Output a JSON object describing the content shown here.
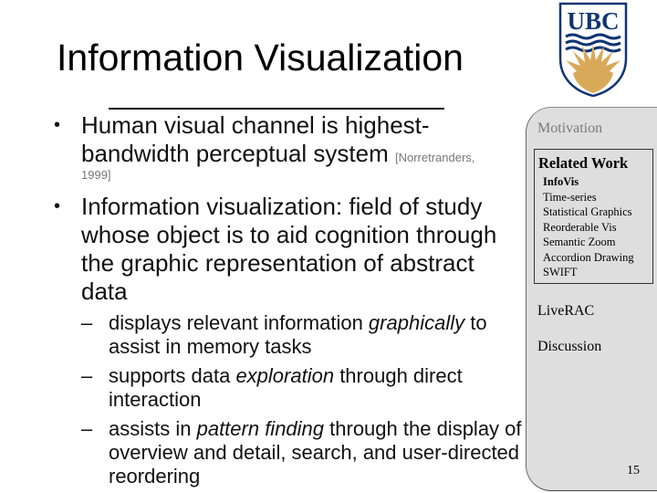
{
  "slide": {
    "title": "Information Visualization",
    "page_number": "15",
    "bullets": [
      {
        "text": "Human visual channel is highest-bandwidth perceptual system",
        "citation_1": "[Norretranders,",
        "citation_2": "1999]"
      },
      {
        "text": "Information visualization: field of study whose object is to aid cognition through the graphic representation of abstract data"
      }
    ],
    "sub_bullets": [
      {
        "before": "displays relevant information ",
        "emph": "graphically",
        "after": " to assist in memory tasks"
      },
      {
        "before": "supports data ",
        "emph": "exploration",
        "after": " through direct interaction"
      },
      {
        "before": "assists in ",
        "emph": "pattern finding",
        "after": " through the display of overview and detail, search, and user-directed reordering"
      }
    ],
    "bullet_marker": "•",
    "sub_marker": "–"
  },
  "logo": {
    "text": "UBC",
    "colors": {
      "navy": "#0f3573",
      "gold": "#d9a95a",
      "white": "#ffffff"
    }
  },
  "nav": {
    "items": {
      "motivation": "Motivation",
      "related_work": "Related Work",
      "liverac": "LiveRAC",
      "discussion": "Discussion"
    },
    "related_work_subitems": [
      {
        "label": "InfoVis",
        "active": true
      },
      {
        "label": "Time-series",
        "active": false
      },
      {
        "label": "Statistical Graphics",
        "active": false
      },
      {
        "label": "Reorderable Vis",
        "active": false
      },
      {
        "label": "Semantic Zoom",
        "active": false
      },
      {
        "label": "Accordion Drawing",
        "active": false
      },
      {
        "label": "SWIFT",
        "active": false
      }
    ],
    "colors": {
      "panel_bg": "#dedede",
      "dim_text": "#7a7a7a"
    }
  }
}
